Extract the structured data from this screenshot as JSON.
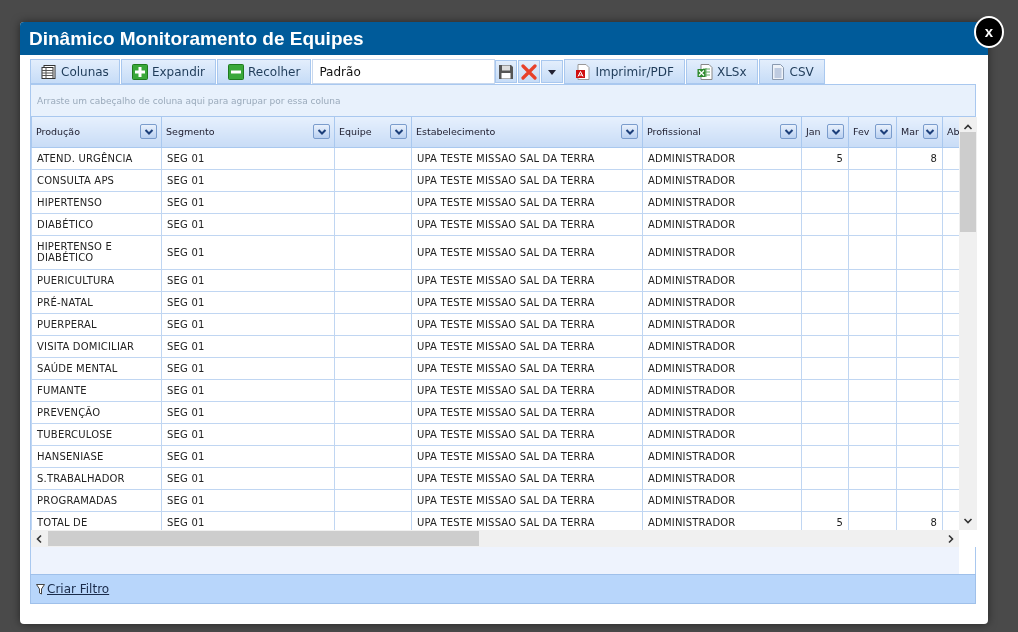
{
  "dialog": {
    "title": "Dinâmico Monitoramento de Equipes",
    "close_label": "x"
  },
  "toolbar": {
    "left_buttons": [
      {
        "label": "Colunas",
        "kind": "columns"
      },
      {
        "label": "Expandir",
        "kind": "expand"
      },
      {
        "label": "Recolher",
        "kind": "collapse"
      }
    ],
    "layout_field": {
      "value": "Padrão"
    },
    "right_buttons": [
      {
        "label": "Imprimir/PDF",
        "kind": "pdf"
      },
      {
        "label": "XLSx",
        "kind": "xlsx"
      },
      {
        "label": "CSV",
        "kind": "csv"
      }
    ]
  },
  "group_panel": {
    "hint": "Arraste um cabeçalho de coluna aqui para agrupar por essa coluna"
  },
  "table": {
    "columns": [
      {
        "label": "Produção",
        "filter": true
      },
      {
        "label": "Segmento",
        "filter": true
      },
      {
        "label": "Equipe",
        "filter": true
      },
      {
        "label": "Estabelecimento",
        "filter": true
      },
      {
        "label": "Profissional",
        "filter": true
      },
      {
        "label": "Jan",
        "filter": true
      },
      {
        "label": "Fev",
        "filter": true
      },
      {
        "label": "Mar",
        "filter": true
      },
      {
        "label": "Ab"
      }
    ],
    "rows": [
      {
        "producao": "ATEND. URGÊNCIA",
        "segmento": "SEG 01",
        "estabelecimento": "UPA TESTE MISSAO SAL DA TERRA",
        "profissional": "ADMINISTRADOR",
        "jan": "5",
        "mar": "8"
      },
      {
        "producao": "CONSULTA APS",
        "segmento": "SEG 01",
        "estabelecimento": "UPA TESTE MISSAO SAL DA TERRA",
        "profissional": "ADMINISTRADOR"
      },
      {
        "producao": "HIPERTENSO",
        "segmento": "SEG 01",
        "estabelecimento": "UPA TESTE MISSAO SAL DA TERRA",
        "profissional": "ADMINISTRADOR"
      },
      {
        "producao": "DIABÉTICO",
        "segmento": "SEG 01",
        "estabelecimento": "UPA TESTE MISSAO SAL DA TERRA",
        "profissional": "ADMINISTRADOR"
      },
      {
        "producao": "HIPERTENSO E DIABÉTICO",
        "segmento": "SEG 01",
        "estabelecimento": "UPA TESTE MISSAO SAL DA TERRA",
        "profissional": "ADMINISTRADOR"
      },
      {
        "producao": "PUERICULTURA",
        "segmento": "SEG 01",
        "estabelecimento": "UPA TESTE MISSAO SAL DA TERRA",
        "profissional": "ADMINISTRADOR"
      },
      {
        "producao": "PRÉ-NATAL",
        "segmento": "SEG 01",
        "estabelecimento": "UPA TESTE MISSAO SAL DA TERRA",
        "profissional": "ADMINISTRADOR"
      },
      {
        "producao": "PUERPERAL",
        "segmento": "SEG 01",
        "estabelecimento": "UPA TESTE MISSAO SAL DA TERRA",
        "profissional": "ADMINISTRADOR"
      },
      {
        "producao": "VISITA DOMICILIAR",
        "segmento": "SEG 01",
        "estabelecimento": "UPA TESTE MISSAO SAL DA TERRA",
        "profissional": "ADMINISTRADOR"
      },
      {
        "producao": "SAÚDE MENTAL",
        "segmento": "SEG 01",
        "estabelecimento": "UPA TESTE MISSAO SAL DA TERRA",
        "profissional": "ADMINISTRADOR"
      },
      {
        "producao": "FUMANTE",
        "segmento": "SEG 01",
        "estabelecimento": "UPA TESTE MISSAO SAL DA TERRA",
        "profissional": "ADMINISTRADOR"
      },
      {
        "producao": "PREVENÇÃO",
        "segmento": "SEG 01",
        "estabelecimento": "UPA TESTE MISSAO SAL DA TERRA",
        "profissional": "ADMINISTRADOR"
      },
      {
        "producao": "TUBERCULOSE",
        "segmento": "SEG 01",
        "estabelecimento": "UPA TESTE MISSAO SAL DA TERRA",
        "profissional": "ADMINISTRADOR"
      },
      {
        "producao": "HANSENIASE",
        "segmento": "SEG 01",
        "estabelecimento": "UPA TESTE MISSAO SAL DA TERRA",
        "profissional": "ADMINISTRADOR"
      },
      {
        "producao": "S.TRABALHADOR",
        "segmento": "SEG 01",
        "estabelecimento": "UPA TESTE MISSAO SAL DA TERRA",
        "profissional": "ADMINISTRADOR"
      },
      {
        "producao": "PROGRAMADAS",
        "segmento": "SEG 01",
        "estabelecimento": "UPA TESTE MISSAO SAL DA TERRA",
        "profissional": "ADMINISTRADOR"
      },
      {
        "producao": "TOTAL DE",
        "segmento": "SEG 01",
        "estabelecimento": "UPA TESTE MISSAO SAL DA TERRA",
        "profissional": "ADMINISTRADOR",
        "jan": "5",
        "mar": "8"
      }
    ]
  },
  "footer": {
    "link": "Criar Filtro"
  }
}
